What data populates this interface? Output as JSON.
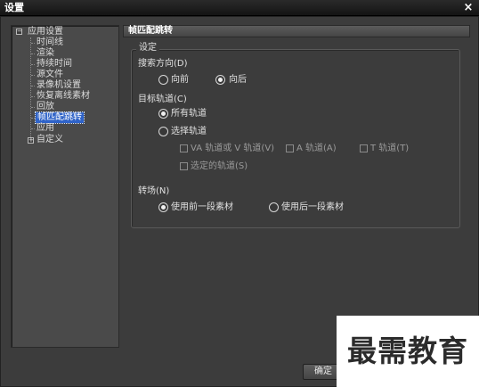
{
  "window": {
    "title": "设置",
    "close_glyph": "×"
  },
  "tree": {
    "root_app": "应用设置",
    "root_app_expander": "−",
    "children": [
      "时间线",
      "渲染",
      "持续时间",
      "源文件",
      "录像机设置",
      "恢复离线素材",
      "回放",
      "帧匹配跳转",
      "应用"
    ],
    "selected": "帧匹配跳转",
    "root_custom": "自定义",
    "root_custom_expander": "+"
  },
  "panel": {
    "header": "帧匹配跳转",
    "group_title": "设定",
    "search_direction": {
      "label": "搜索方向(D)",
      "options": [
        "向前",
        "向后"
      ],
      "selected": "向后"
    },
    "target_track": {
      "label": "目标轨道(C)",
      "all_tracks": "所有轨道",
      "select_tracks": "选择轨道",
      "selected": "所有轨道",
      "va_tracks": "VA 轨道或 V 轨道(V)",
      "a_tracks": "A 轨道(A)",
      "t_tracks": "T 轨道(T)",
      "selected_tracks": "选定的轨道(S)"
    },
    "transition": {
      "label": "转场(N)",
      "options": [
        "使用前一段素材",
        "使用后一段素材"
      ],
      "selected": "使用前一段素材"
    }
  },
  "buttons": {
    "ok": "确定"
  },
  "watermark": "最需教育"
}
